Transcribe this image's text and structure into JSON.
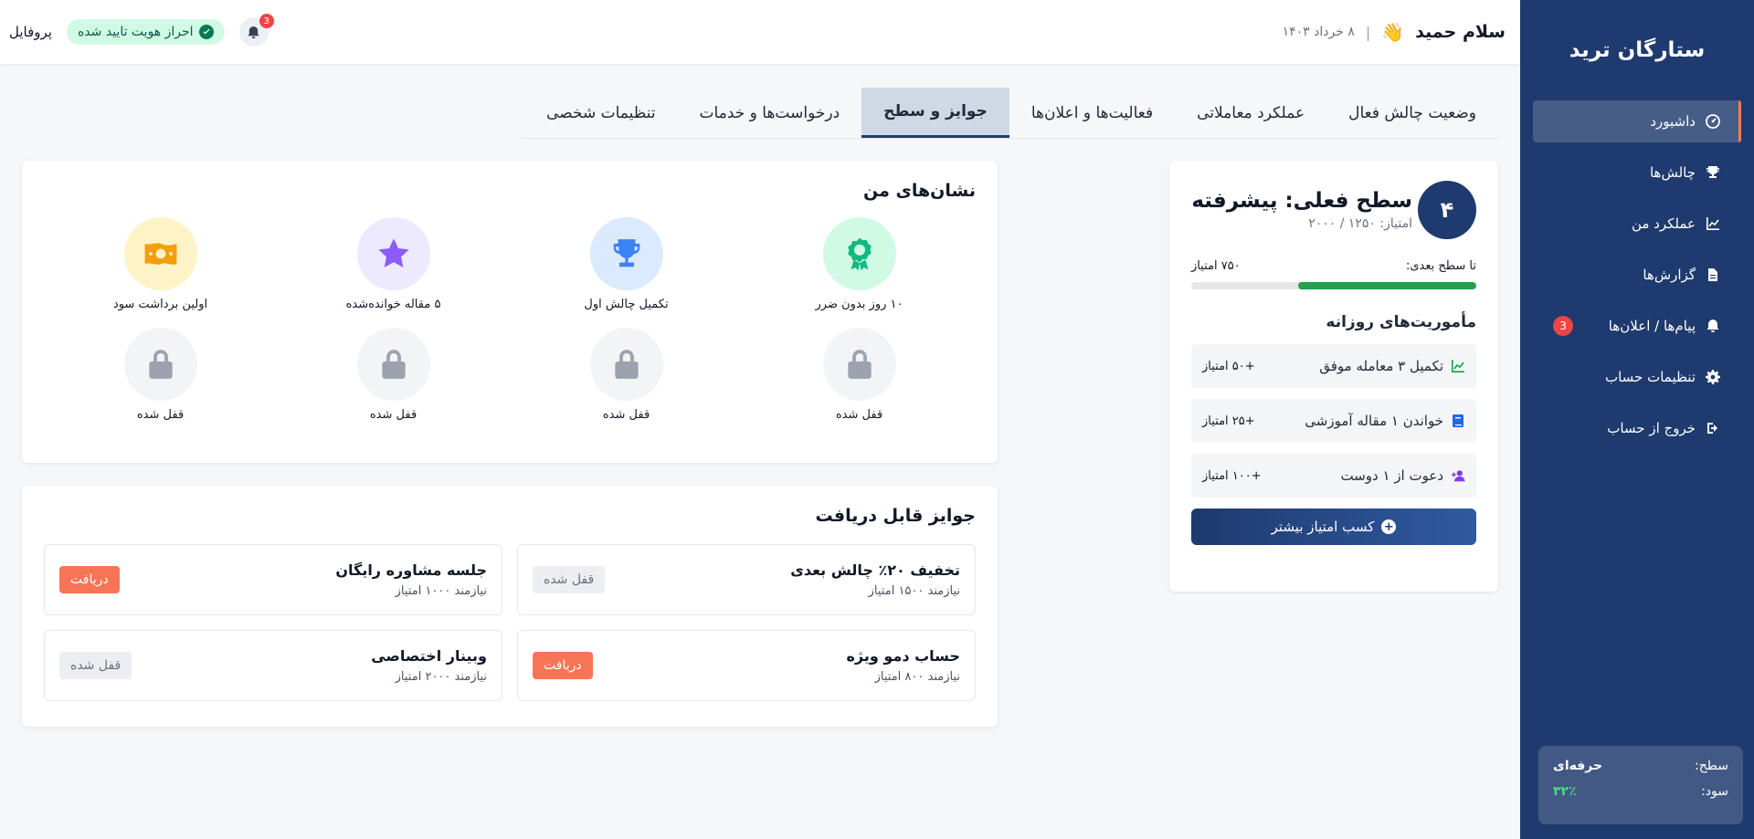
{
  "sidebar": {
    "brand": "ستارگان ترید",
    "items": [
      {
        "label": "داشبورد",
        "icon": "dashboard-icon"
      },
      {
        "label": "چالش‌ها",
        "icon": "trophy-icon"
      },
      {
        "label": "عملکرد من",
        "icon": "chart-line-icon"
      },
      {
        "label": "گزارش‌ها",
        "icon": "file-icon"
      },
      {
        "label": "پیام‌ها / اعلان‌ها",
        "icon": "bell-icon",
        "badge": "3"
      },
      {
        "label": "تنظیمات حساب",
        "icon": "gear-icon"
      },
      {
        "label": "خروج از حساب",
        "icon": "logout-icon"
      }
    ],
    "level_card": {
      "level_label": "سطح:",
      "level_value": "حرفه‌ای",
      "profit_label": "سود:",
      "profit_value": "۳۲٪"
    }
  },
  "header": {
    "greeting": "سلام حمید",
    "hand_emoji": "👋",
    "separator": "|",
    "date": "۸ خرداد ۱۴۰۳",
    "notification_count": "3",
    "verified_label": "احراز هویت تایید شده",
    "profile_label": "پروفایل"
  },
  "tabs": [
    {
      "label": "وضعیت چالش فعال",
      "active": false
    },
    {
      "label": "عملکرد معاملاتی",
      "active": false
    },
    {
      "label": "فعالیت‌ها و اعلان‌ها",
      "active": false
    },
    {
      "label": "جوایز و سطح",
      "active": true
    },
    {
      "label": "درخواست‌ها و خدمات",
      "active": false
    },
    {
      "label": "تنظیمات شخصی",
      "active": false
    }
  ],
  "level": {
    "number": "۴",
    "title": "سطح فعلی: پیشرفته",
    "points": "امتیاز: ۱۲۵۰ / ۲۰۰۰",
    "next_label": "تا سطح بعدی:",
    "next_value": "۷۵۰ امتیاز",
    "progress": 0.625,
    "progress_color": "#22a04b",
    "missions_title": "مأموریت‌های روزانه",
    "missions": [
      {
        "label": "تکمیل ۳ معامله موفق",
        "points": "+۵۰ امتیاز",
        "icon": "chart-line-icon",
        "color": "#16a34a"
      },
      {
        "label": "خواندن ۱ مقاله آموزشی",
        "points": "+۲۵ امتیاز",
        "icon": "book-icon",
        "color": "#2563eb"
      },
      {
        "label": "دعوت از ۱ دوست",
        "points": "+۱۰۰ امتیاز",
        "icon": "user-plus-icon",
        "color": "#7c3aed"
      }
    ],
    "cta_label": "کسب امتیاز بیشتر"
  },
  "badges": {
    "title": "نشان‌های من",
    "items": [
      {
        "label": "۱۰ روز بدون ضرر",
        "icon": "award-icon",
        "bg": "#d1fae5",
        "fg": "#10b981"
      },
      {
        "label": "تکمیل چالش اول",
        "icon": "trophy-icon",
        "bg": "#dbeafe",
        "fg": "#3b82f6"
      },
      {
        "label": "۵ مقاله خوانده‌شده",
        "icon": "star-icon",
        "bg": "#ede9fe",
        "fg": "#8b5cf6"
      },
      {
        "label": "اولین برداشت سود",
        "icon": "money-icon",
        "bg": "#fef3c7",
        "fg": "#f59e0b"
      },
      {
        "label": "قفل شده",
        "icon": "lock-icon",
        "bg": "#f3f4f6",
        "fg": "#9ca3af"
      },
      {
        "label": "قفل شده",
        "icon": "lock-icon",
        "bg": "#f3f4f6",
        "fg": "#9ca3af"
      },
      {
        "label": "قفل شده",
        "icon": "lock-icon",
        "bg": "#f3f4f6",
        "fg": "#9ca3af"
      },
      {
        "label": "قفل شده",
        "icon": "lock-icon",
        "bg": "#f3f4f6",
        "fg": "#9ca3af"
      }
    ]
  },
  "rewards": {
    "title": "جوایز قابل دریافت",
    "items": [
      {
        "title": "تخفیف ۲۰٪ چالش بعدی",
        "requirement": "نیازمند ۱۵۰۰ امتیاز",
        "action": "قفل شده",
        "state": "locked"
      },
      {
        "title": "جلسه مشاوره رایگان",
        "requirement": "نیازمند ۱۰۰۰ امتیاز",
        "action": "دریافت",
        "state": "claim"
      },
      {
        "title": "حساب دمو ویژه",
        "requirement": "نیازمند ۸۰۰ امتیاز",
        "action": "دریافت",
        "state": "claim"
      },
      {
        "title": "وبینار اختصاصی",
        "requirement": "نیازمند ۲۰۰۰ امتیاز",
        "action": "قفل شده",
        "state": "locked"
      }
    ]
  }
}
